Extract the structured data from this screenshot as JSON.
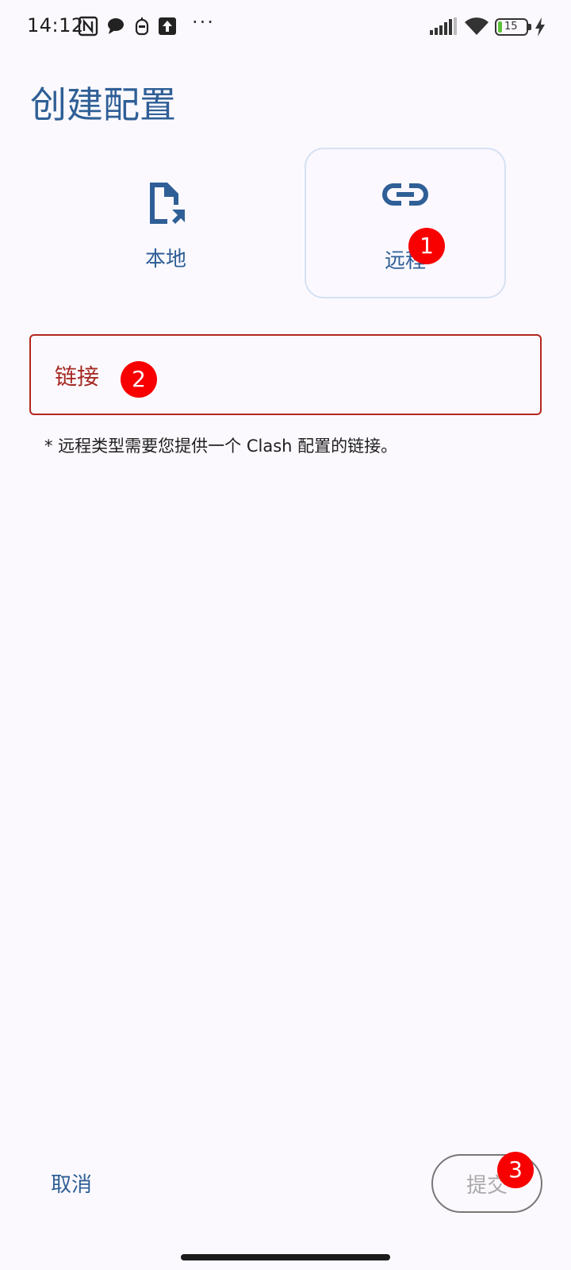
{
  "status_bar": {
    "time": "14:12",
    "more_indicator": "···",
    "battery_level": "15",
    "icons": [
      "nfc-icon",
      "chat-bubble-icon",
      "robot-icon",
      "upload-icon",
      "signal-icon",
      "wifi-icon",
      "battery-icon",
      "charging-icon"
    ]
  },
  "page": {
    "title": "创建配置"
  },
  "types": {
    "local": {
      "label": "本地",
      "icon": "file-arrow-icon"
    },
    "remote": {
      "label": "远程",
      "icon": "link-icon",
      "selected": true
    }
  },
  "url_field": {
    "label": "链接",
    "value": "",
    "hint": "* 远程类型需要您提供一个 Clash 配置的链接。",
    "error_color": "#b3261e"
  },
  "actions": {
    "cancel_label": "取消",
    "submit_label": "提交",
    "submit_enabled": false
  },
  "markers": [
    "1",
    "2",
    "3"
  ],
  "colors": {
    "accent": "#2f5f96",
    "background": "#fcf9fe",
    "marker": "#f80000"
  }
}
